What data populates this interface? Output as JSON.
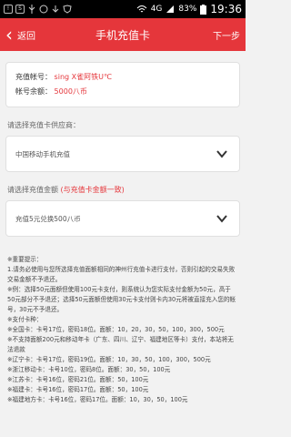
{
  "status": {
    "time": "19:36",
    "battery": "83%",
    "network": "4G",
    "icons": [
      "notification-icon",
      "app-icon",
      "wifi-icon",
      "signal-icon",
      "battery-icon"
    ]
  },
  "header": {
    "back_label": "返回",
    "title": "手机充值卡",
    "next_label": "下一步"
  },
  "account": {
    "recharge_label": "充值帐号：",
    "recharge_value": "sing",
    "recharge_extra": "X雀阿铁U℃",
    "balance_label": "帐号余额：",
    "balance_value": "5000八币"
  },
  "operator": {
    "label": "请选择充值卡供应商：",
    "selected": "中国移动手机充值"
  },
  "amount": {
    "label": "请选择充值金额",
    "hint": "(与充值卡金额一致)",
    "selected": "充值5元兑换500八币"
  },
  "notes": [
    "※重要提示：",
    "1.请务必使用与您所选择充值面额相同的神州行充值卡进行支付，否则引起的交易失败交易金额不予退还。",
    "※例：选择50元面额但使用100元卡支付，则系统认为您实际支付金额为50元，高于50元部分不予退还；选择50元面额但使用30元卡支付则卡内30元将被直接充入您的帐号，30元不予退还。",
    "※支付卡种：",
    "※全国卡：卡号17位，密码18位。面额：10，20，30，50，100，300，500元",
    "※不支持面额200元和移动年卡（广东、四川、辽宁、福建地区等卡）支付，本站将无法退款",
    "※辽宁卡：卡号17位，密码19位。面额：10，30，50，100，300，500元",
    "※浙江移动卡：卡号10位，密码8位。面额：30，50，100元",
    "※江苏卡：卡号16位，密码21位。面额：50，100元",
    "※福建卡：卡号16位，密码17位。面额：50，100元",
    "※福建地方卡：卡号16位，密码17位。面额：10，30，50，100元"
  ]
}
